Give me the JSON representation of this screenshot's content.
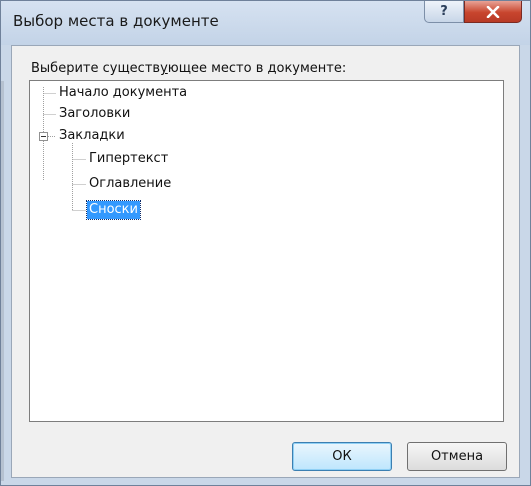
{
  "window": {
    "title": "Выбор места в документе",
    "help_symbol": "?",
    "close_symbol": "×"
  },
  "dialog": {
    "prompt_before": "Выберите существ",
    "prompt_underlined": "у",
    "prompt_after": "ющее место в документе:"
  },
  "tree": {
    "root_items": [
      {
        "label": "Начало документа"
      },
      {
        "label": "Заголовки"
      },
      {
        "label": "Закладки",
        "expanded": true
      }
    ],
    "bookmarks": [
      {
        "label": "Гипертекст"
      },
      {
        "label": "Оглавление"
      },
      {
        "label": "Сноски",
        "selected": true
      }
    ]
  },
  "buttons": {
    "ok": "ОК",
    "cancel": "Отмена"
  },
  "colors": {
    "selection": "#3399ff",
    "close_button": "#c8452e",
    "titlebar": "#c9d7e8"
  }
}
